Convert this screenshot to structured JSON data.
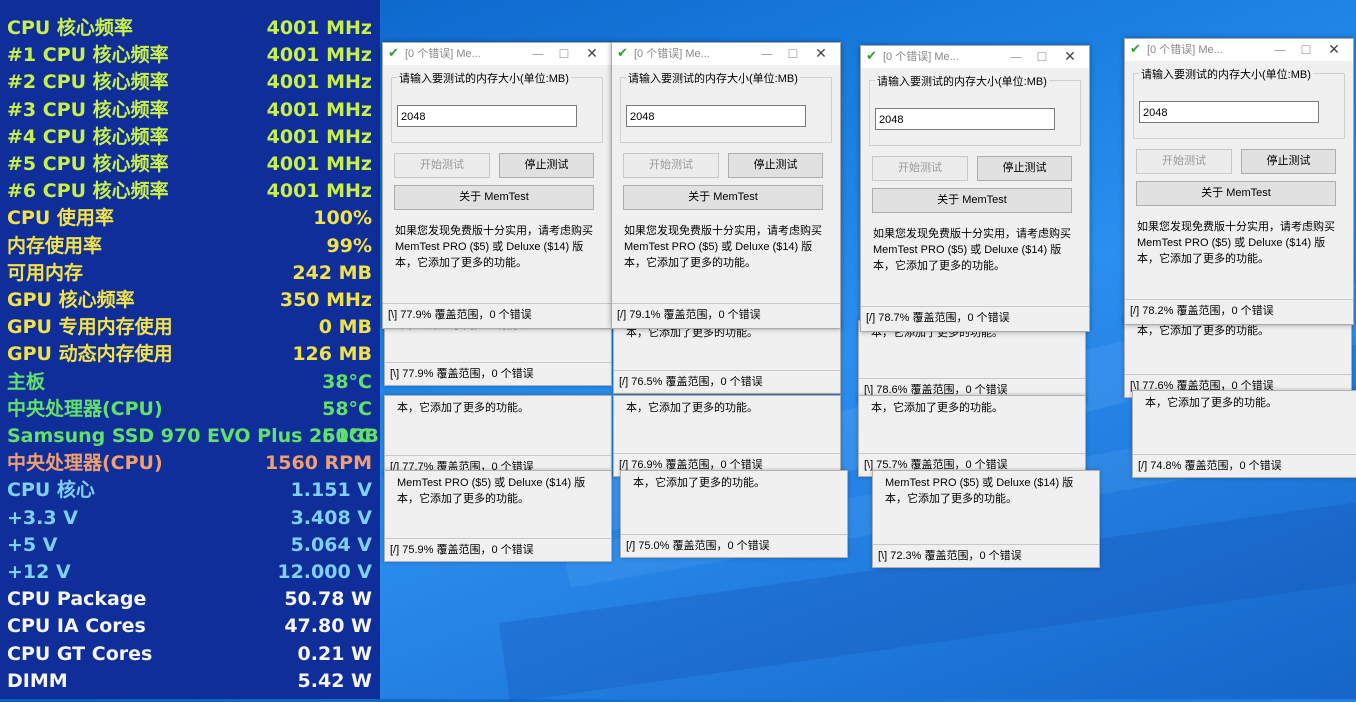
{
  "osd": {
    "rows": [
      {
        "label": "CPU 核心频率",
        "value": "4001 MHz",
        "color": "#c8f04a"
      },
      {
        "label": "#1 CPU 核心频率",
        "value": "4001 MHz",
        "color": "#c8f04a"
      },
      {
        "label": "#2 CPU 核心频率",
        "value": "4001 MHz",
        "color": "#c8f04a"
      },
      {
        "label": "#3 CPU 核心频率",
        "value": "4001 MHz",
        "color": "#c8f04a"
      },
      {
        "label": "#4 CPU 核心频率",
        "value": "4001 MHz",
        "color": "#c8f04a"
      },
      {
        "label": "#5 CPU 核心频率",
        "value": "4001 MHz",
        "color": "#c8f04a"
      },
      {
        "label": "#6 CPU 核心频率",
        "value": "4001 MHz",
        "color": "#c8f04a"
      },
      {
        "label": "CPU 使用率",
        "value": "100%",
        "color": "#f2e24a"
      },
      {
        "label": "内存使用率",
        "value": "99%",
        "color": "#f2e24a"
      },
      {
        "label": "可用内存",
        "value": "242 MB",
        "color": "#f2e24a"
      },
      {
        "label": "GPU 核心频率",
        "value": "350 MHz",
        "color": "#f2e24a"
      },
      {
        "label": "GPU 专用内存使用",
        "value": "0 MB",
        "color": "#f2e24a"
      },
      {
        "label": "GPU 动态内存使用",
        "value": "126 MB",
        "color": "#f2e24a"
      },
      {
        "label": "主板",
        "value": "38°C",
        "color": "#63e06a"
      },
      {
        "label": "中央处理器(CPU)",
        "value": "58°C",
        "color": "#63e06a"
      },
      {
        "label": "Samsung SSD 970 EVO Plus 250GB",
        "value": "61°C",
        "color": "#63e06a"
      },
      {
        "label": "中央处理器(CPU)",
        "value": "1560 RPM",
        "color": "#f0a070"
      },
      {
        "label": "CPU 核心",
        "value": "1.151 V",
        "color": "#7fd0f5"
      },
      {
        "label": "+3.3 V",
        "value": "3.408 V",
        "color": "#7fd0f5"
      },
      {
        "label": "+5 V",
        "value": "5.064 V",
        "color": "#7fd0f5"
      },
      {
        "label": "+12 V",
        "value": "12.000 V",
        "color": "#7fd0f5"
      },
      {
        "label": "CPU Package",
        "value": "50.78 W",
        "color": "#f5f5f5"
      },
      {
        "label": "CPU IA Cores",
        "value": "47.80 W",
        "color": "#f5f5f5"
      },
      {
        "label": "CPU GT Cores",
        "value": "0.21 W",
        "color": "#f5f5f5"
      },
      {
        "label": "DIMM",
        "value": "5.42 W",
        "color": "#f5f5f5"
      }
    ]
  },
  "memtest": {
    "title": "[0 个错误] Me...",
    "minimize": "—",
    "maximize": "☐",
    "close": "✕",
    "group_label": "请输入要测试的内存大小(单位:MB)",
    "input_value": "2048",
    "start_label": "开始测试",
    "stop_label": "停止测试",
    "about_label": "关于 MemTest",
    "info_full": "如果您发现免费版十分实用，请考虑购买 MemTest PRO ($5) 或 Deluxe ($14) 版本，它添加了更多的功能。",
    "info_tail": "本，它添加了更多的功能。",
    "info_pro": "MemTest PRO ($5) 或 Deluxe ($14) 版本，它添加了更多的功能。",
    "windows": [
      {
        "status": "[\\]   77.9% 覆盖范围，0 个错误"
      },
      {
        "status": "[/]   79.1% 覆盖范围，0 个错误"
      },
      {
        "status": "[/]   78.7% 覆盖范围，0 个错误"
      },
      {
        "status": "[/]   78.2% 覆盖范围，0 个错误"
      }
    ],
    "strips": [
      {
        "text": "本，它添加了更多的功能。",
        "status": "[\\]   77.9% 覆盖范围，0 个错误"
      },
      {
        "text": "本，它添加了更多的功能。",
        "status": "[/]   77.7% 覆盖范围，0 个错误"
      },
      {
        "text": "MemTest PRO ($5) 或 Deluxe ($14) 版本，它添加了更多的功能。",
        "status": "[/]   75.9% 覆盖范围，0 个错误"
      },
      {
        "text": "本，它添加了更多的功能。",
        "status": "[/]   76.5% 覆盖范围，0 个错误"
      },
      {
        "text": "本，它添加了更多的功能。",
        "status": "[/]   76.9% 覆盖范围，0 个错误"
      },
      {
        "text": "本，它添加了更多的功能。",
        "status": "[/]   75.0% 覆盖范围，0 个错误"
      },
      {
        "text": "本，它添加了更多的功能。",
        "status": "[\\]   78.6% 覆盖范围，0 个错误"
      },
      {
        "text": "本，它添加了更多的功能。",
        "status": "[\\]   75.7% 覆盖范围，0 个错误"
      },
      {
        "text": "MemTest PRO ($5) 或 Deluxe ($14) 版本，它添加了更多的功能。",
        "status": "[\\]   72.3% 覆盖范围，0 个错误"
      },
      {
        "text": "本，它添加了更多的功能。",
        "status": "[\\]   77.6% 覆盖范围，0 个错误"
      },
      {
        "text": "本，它添加了更多的功能。",
        "status": "[/]   74.8% 覆盖范围，0 个错误"
      }
    ]
  }
}
